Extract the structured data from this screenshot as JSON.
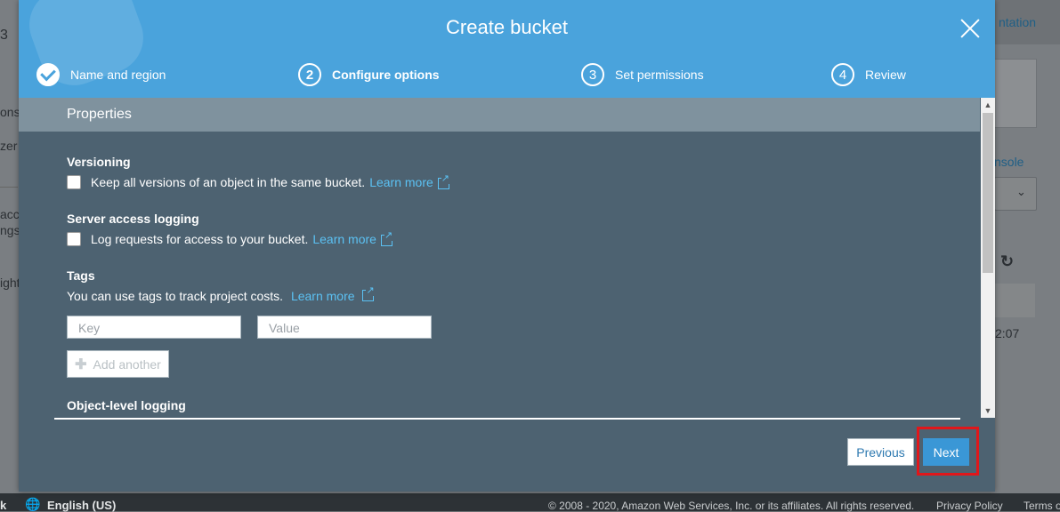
{
  "background": {
    "left_fragments": [
      "3",
      "ons",
      "zer",
      "acc",
      "ngs",
      "ight"
    ],
    "right_fragments": {
      "link_top": "ntation",
      "link_mid": "nsole",
      "time": "2:07"
    }
  },
  "footer": {
    "feedback_fragment": "k",
    "language": "English (US)",
    "copyright": "© 2008 - 2020, Amazon Web Services, Inc. or its affiliates. All rights reserved.",
    "privacy": "Privacy Policy",
    "terms": "Terms o"
  },
  "modal": {
    "title": "Create bucket",
    "steps": [
      {
        "number": "1",
        "label": "Name and region",
        "state": "done"
      },
      {
        "number": "2",
        "label": "Configure options",
        "state": "active"
      },
      {
        "number": "3",
        "label": "Set permissions",
        "state": "pending"
      },
      {
        "number": "4",
        "label": "Review",
        "state": "pending"
      }
    ],
    "properties_title": "Properties",
    "versioning": {
      "title": "Versioning",
      "label": "Keep all versions of an object in the same bucket.",
      "learn_more": "Learn more"
    },
    "logging": {
      "title": "Server access logging",
      "label": "Log requests for access to your bucket.",
      "learn_more": "Learn more"
    },
    "tags": {
      "title": "Tags",
      "description": "You can use tags to track project costs.",
      "learn_more": "Learn more",
      "key_placeholder": "Key",
      "value_placeholder": "Value",
      "add_another": "Add another"
    },
    "object_logging": {
      "title": "Object-level logging"
    },
    "buttons": {
      "previous": "Previous",
      "next": "Next"
    }
  },
  "colors": {
    "header": "#4aa3dc",
    "body": "#4d6271",
    "link": "#5bc1f3",
    "primary": "#3a97d6",
    "highlight": "#e0171b"
  }
}
